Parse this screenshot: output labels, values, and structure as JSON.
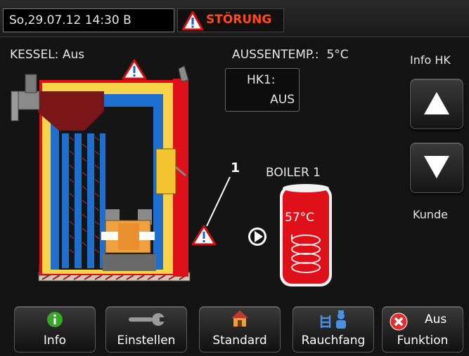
{
  "header": {
    "datetime": "So,29.07.12 14:30 B",
    "alarm_label": "STÖRUNG"
  },
  "status": {
    "boiler_status": "KESSEL: Aus",
    "outdoor_temp": "AUSSENTEMP.:  5°C",
    "hk1_title": "HK1:",
    "hk1_value": "AUS"
  },
  "right_panel": {
    "info_label": "Info HK",
    "customer_label": "Kunde"
  },
  "diagram": {
    "callout_number": "1",
    "boiler_title": "BOILER 1",
    "boiler_temp": "57°C"
  },
  "toolbar": {
    "info_label": "Info",
    "settings_label": "Einstellen",
    "standard_label": "Standard",
    "chimney_label": "Rauchfang",
    "function_label_top": "Aus",
    "function_label_bottom": "Funktion"
  },
  "colors": {
    "alarm": "#ff4a1a",
    "boiler_red": "#e0101a",
    "water_blue": "#1e6fd0",
    "insulation_yellow": "#f5d44a"
  }
}
